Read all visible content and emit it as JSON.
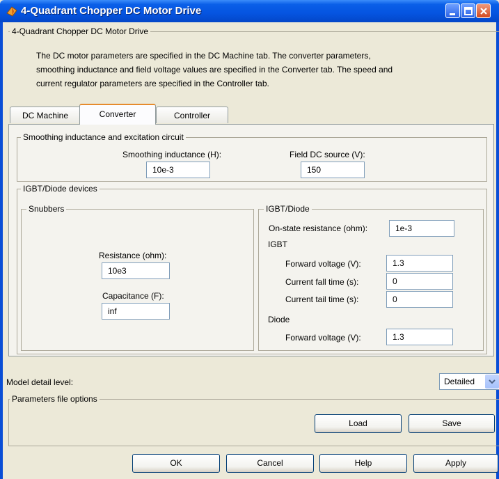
{
  "window": {
    "title": "4-Quadrant Chopper DC Motor Drive",
    "controls": [
      "minimize",
      "maximize",
      "close"
    ]
  },
  "header_group": {
    "label": "4-Quadrant Chopper DC Motor Drive",
    "description_lines": [
      "The DC motor parameters are specified in the DC Machine tab. The converter parameters,",
      "smoothing inductance and field voltage values are specified in the Converter tab. The speed and",
      "current regulator parameters are specified in the Controller tab."
    ]
  },
  "tabs": [
    {
      "label": "DC Machine",
      "active": false
    },
    {
      "label": "Converter",
      "active": true
    },
    {
      "label": "Controller",
      "active": false
    }
  ],
  "converter": {
    "smoothing_group": {
      "label": "Smoothing inductance and excitation circuit",
      "inductance_label": "Smoothing inductance (H):",
      "inductance_value": "10e-3",
      "field_label": "Field DC source (V):",
      "field_value": "150"
    },
    "igbt_diode_group": {
      "label": "IGBT/Diode devices",
      "snubbers": {
        "label": "Snubbers",
        "resistance_label": "Resistance (ohm):",
        "resistance_value": "10e3",
        "capacitance_label": "Capacitance (F):",
        "capacitance_value": "inf"
      },
      "igbt_diode": {
        "label": "IGBT/Diode",
        "on_state_label": "On-state resistance (ohm):",
        "on_state_value": "1e-3",
        "igbt_label": "IGBT",
        "igbt_forward_label": "Forward voltage (V):",
        "igbt_forward_value": "1.3",
        "fall_time_label": "Current fall time (s):",
        "fall_time_value": "0",
        "tail_time_label": "Current tail time (s):",
        "tail_time_value": "0",
        "diode_label": "Diode",
        "diode_forward_label": "Forward voltage (V):",
        "diode_forward_value": "1.3"
      }
    }
  },
  "model_detail": {
    "label": "Model detail level:",
    "selected": "Detailed"
  },
  "params_file": {
    "label": "Parameters file options",
    "load": "Load",
    "save": "Save"
  },
  "footer": {
    "ok": "OK",
    "cancel": "Cancel",
    "help": "Help",
    "apply": "Apply"
  },
  "colors": {
    "title_bar": "#0554e0",
    "dialog_bg": "#ece9d8",
    "active_tab_accent": "#e68b2c"
  },
  "icons": [
    "simulink-app-icon",
    "minimize-icon",
    "maximize-icon",
    "close-icon",
    "chevron-down-icon"
  ]
}
